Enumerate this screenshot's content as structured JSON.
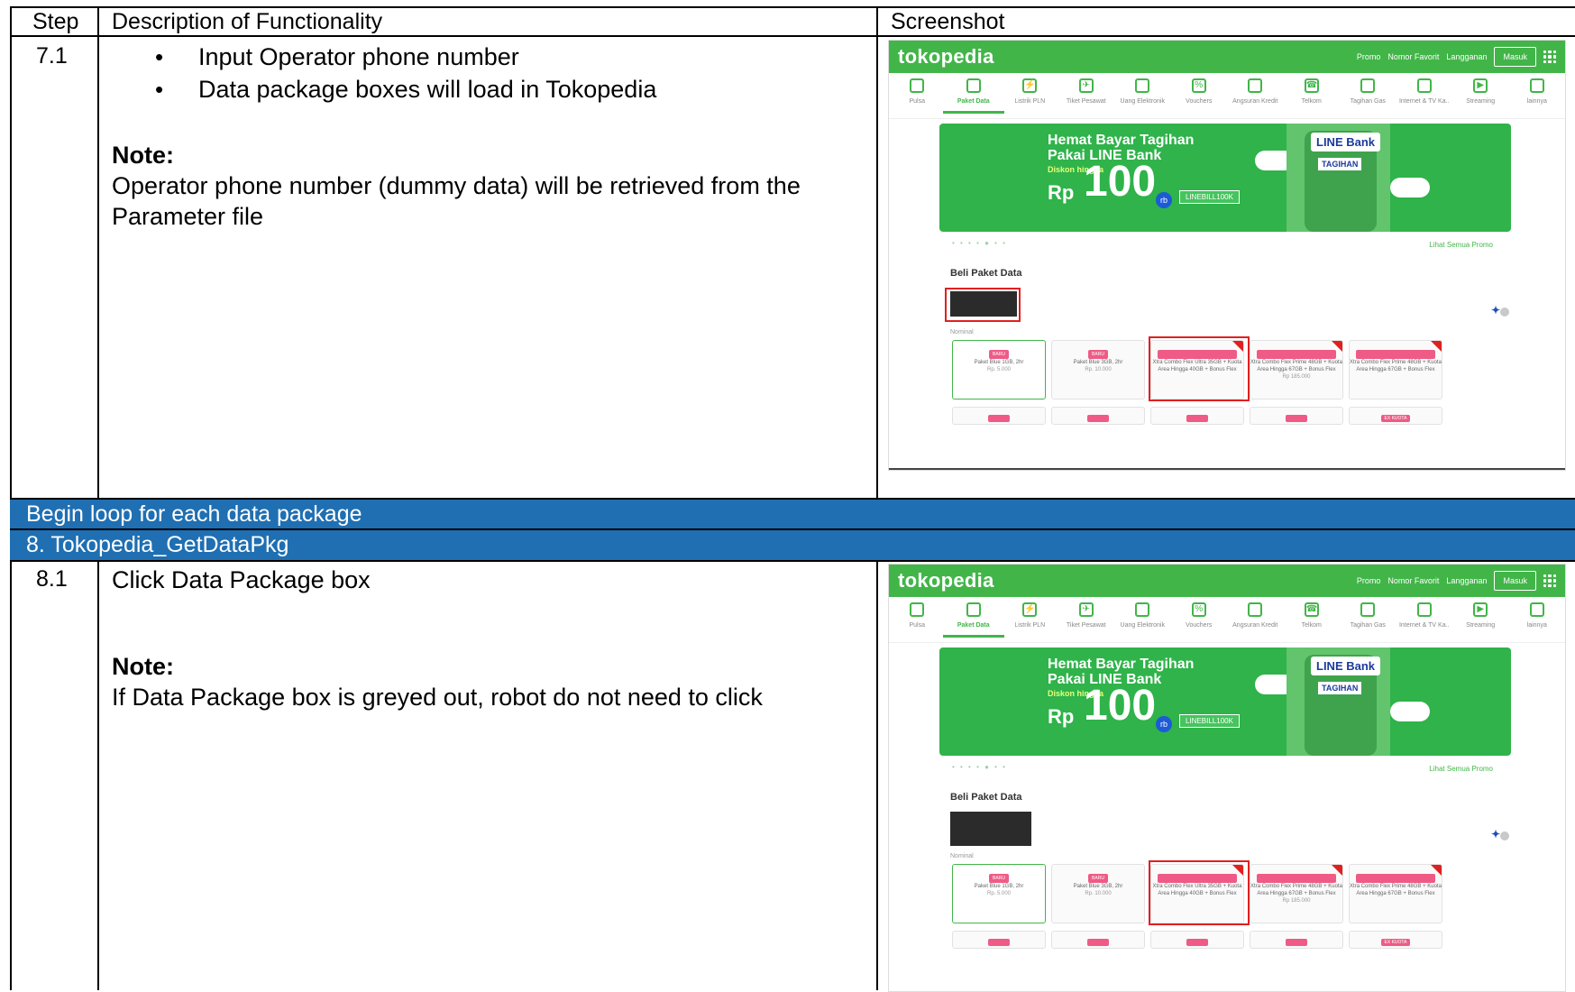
{
  "header": {
    "step": "Step",
    "description": "Description of Functionality",
    "screenshot": "Screenshot"
  },
  "row71": {
    "step": "7.1",
    "bullets": [
      "Input Operator phone number",
      "Data package boxes will load in Tokopedia"
    ],
    "note_label": "Note:",
    "note_lines": [
      "Operator phone number (dummy data) will be retrieved from the",
      "Parameter file"
    ]
  },
  "loop_bar": "Begin loop for each data package",
  "section8": "8.   Tokopedia_GetDataPkg",
  "row81": {
    "step": "8.1",
    "desc": "Click Data Package box",
    "note_label": "Note:",
    "note_text": "If Data Package box is greyed out, robot do not need to click"
  },
  "tokopedia": {
    "logo": "tokopedia",
    "nav_links": [
      "Promo",
      "Nomor Favorit",
      "Langganan"
    ],
    "login": "Masuk",
    "categories": [
      "Pulsa",
      "Paket Data",
      "Listrik PLN",
      "Tiket Pesawat",
      "Uang Elektronik",
      "Vouchers",
      "Angsuran Kredit",
      "Telkom",
      "Tagihan Gas",
      "Internet & TV Ka..",
      "Streaming",
      "lainnya"
    ],
    "active_category": "Paket Data",
    "banner": {
      "title": "Hemat Bayar Tagihan Pakai LINE Bank",
      "diskon": "Diskon hingga",
      "rp": "Rp",
      "amount": "100",
      "unit": "rb",
      "code": "LINEBILL100K",
      "brand": "LINE Bank",
      "tag": "TAGIHAN"
    },
    "all_promo": "Lihat Semua Promo",
    "section_title": "Beli Paket Data",
    "nominal_label": "Nominal",
    "cards": [
      {
        "pill": "BARU",
        "name": "Paket Blue 1GB, 2hr",
        "price": "Rp. 5.000"
      },
      {
        "pill": "BARU",
        "name": "Paket Blue 3GB, 2hr",
        "price": "Rp. 10.000"
      },
      {
        "pill": "",
        "name": "Xtra Combo Flex Ultra 35GB + Kuota Area Hingga 40GB + Bonus Flex",
        "price": ""
      },
      {
        "pill": "",
        "name": "Xtra Combo Flex Prime 48GB + Kuota Area Hingga 67GB + Bonus Flex",
        "price": "Rp 185.000"
      },
      {
        "pill": "",
        "name": "Xtra Combo Flex Prime 48GB + Kuota Area Hingga 67GB + Bonus Flex",
        "price": ""
      }
    ],
    "ex_kuota": "EX KUOTA",
    "colors": {
      "brand": "#42b549",
      "highlight": "#e02020",
      "bar": "#1f6fb2"
    }
  }
}
